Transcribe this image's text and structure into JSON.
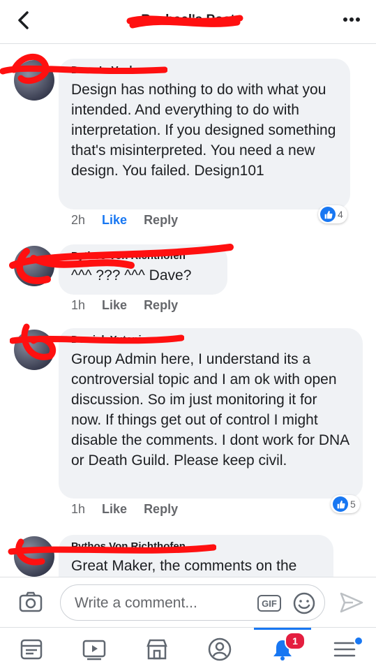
{
  "header": {
    "title": "Rachael's Post"
  },
  "comments": [
    {
      "author": "Dave LeVack",
      "text": "Design has nothing to do with what you intended. And everything to do with interpretation. If you designed something that's misinterpreted. You need a new design. You failed. Design101",
      "time": "2h",
      "like_label": "Like",
      "reply_label": "Reply",
      "reaction_count": "4",
      "liked": true
    },
    {
      "author": "Pythos Von Richthofen",
      "text": "^^^ ??? ^^^ Dave?",
      "time": "1h",
      "like_label": "Like",
      "reply_label": "Reply"
    },
    {
      "author": "Derrick Yutani",
      "text": "Group Admin here, I understand its a controversial topic and I am ok with open discussion. So im just monitoring it for now. If things get out of control I might disable the comments. I dont work for DNA or Death Guild.  Please keep civil.",
      "time": "1h",
      "like_label": "Like",
      "reply_label": "Reply",
      "reaction_count": "5"
    },
    {
      "author": "Pythos Von Richthofen",
      "text": "Great Maker, the comments on the"
    }
  ],
  "composer": {
    "placeholder": "Write a comment...",
    "gif_label": "GIF"
  },
  "bottom_nav": {
    "notifications_badge": "1"
  },
  "colors": {
    "accent": "#1877f2",
    "bubble": "#f0f2f5",
    "scribble": "#ff0000",
    "badge": "#e41e3f"
  }
}
